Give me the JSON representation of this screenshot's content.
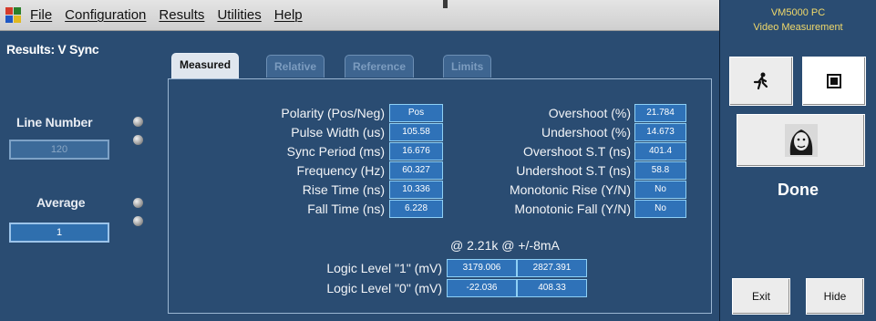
{
  "menu": {
    "items": [
      "File",
      "Configuration",
      "Results",
      "Utilities",
      "Help"
    ]
  },
  "left": {
    "title": "Results: V Sync",
    "line_number_label": "Line Number",
    "line_number_value": "120",
    "average_label": "Average",
    "average_value": "1"
  },
  "tabs": [
    "Measured",
    "Relative",
    "Reference",
    "Limits"
  ],
  "measurements_left": [
    {
      "label": "Polarity (Pos/Neg)",
      "value": "Pos"
    },
    {
      "label": "Pulse Width (us)",
      "value": "105.58"
    },
    {
      "label": "Sync Period (ms)",
      "value": "16.676"
    },
    {
      "label": "Frequency (Hz)",
      "value": "60.327"
    },
    {
      "label": "Rise Time (ns)",
      "value": "10.336"
    },
    {
      "label": "Fall Time (ns)",
      "value": "6.228"
    }
  ],
  "measurements_right": [
    {
      "label": "Overshoot (%)",
      "value": "21.784"
    },
    {
      "label": "Undershoot (%)",
      "value": "14.673"
    },
    {
      "label": "Overshoot S.T (ns)",
      "value": "401.4"
    },
    {
      "label": "Undershoot S.T (ns)",
      "value": "58.8"
    },
    {
      "label": "Monotonic Rise (Y/N)",
      "value": "No"
    },
    {
      "label": "Monotonic Fall (Y/N)",
      "value": "No"
    }
  ],
  "logic": {
    "header": "@ 2.21k  @ +/-8mA",
    "rows": [
      {
        "label": "Logic Level \"1\" (mV)",
        "v1": "3179.006",
        "v2": "2827.391"
      },
      {
        "label": "Logic Level \"0\" (mV)",
        "v1": "-22.036",
        "v2": "408.33"
      }
    ]
  },
  "right": {
    "brand_line1": "VM5000 PC",
    "brand_line2": "Video Measurement",
    "status": "Done",
    "exit_label": "Exit",
    "hide_label": "Hide"
  },
  "colors": {
    "panel_bg": "#2a4c72",
    "value_bg": "#2f72b8",
    "brand_text": "#f0d86a"
  },
  "icons": [
    "app-icon",
    "run-icon",
    "stop-icon",
    "face-icon"
  ]
}
